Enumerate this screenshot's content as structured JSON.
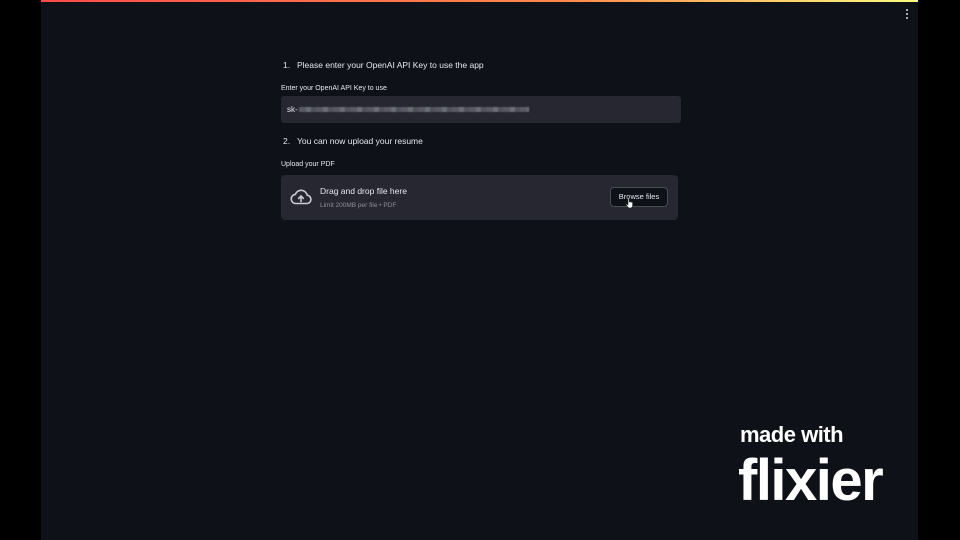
{
  "steps": [
    {
      "number": "1.",
      "text": "Please enter your OpenAI API Key to use the app"
    },
    {
      "number": "2.",
      "text": "You can now upload your resume"
    }
  ],
  "api_key": {
    "label": "Enter your OpenAI API Key to use",
    "value_prefix": "sk-"
  },
  "uploader": {
    "label": "Upload your PDF",
    "title": "Drag and drop file here",
    "limit": "Limit 200MB per file • PDF",
    "browse_label": "Browse files"
  },
  "watermark": {
    "line1": "made with",
    "line2": "flixier"
  },
  "colors": {
    "background": "#0e1117",
    "widget": "#262730",
    "accent_red": "#ff4b4b",
    "accent_yellow": "#fffd80"
  },
  "icons": [
    "menu-icon",
    "cloud-upload-icon",
    "hand-cursor-icon"
  ]
}
